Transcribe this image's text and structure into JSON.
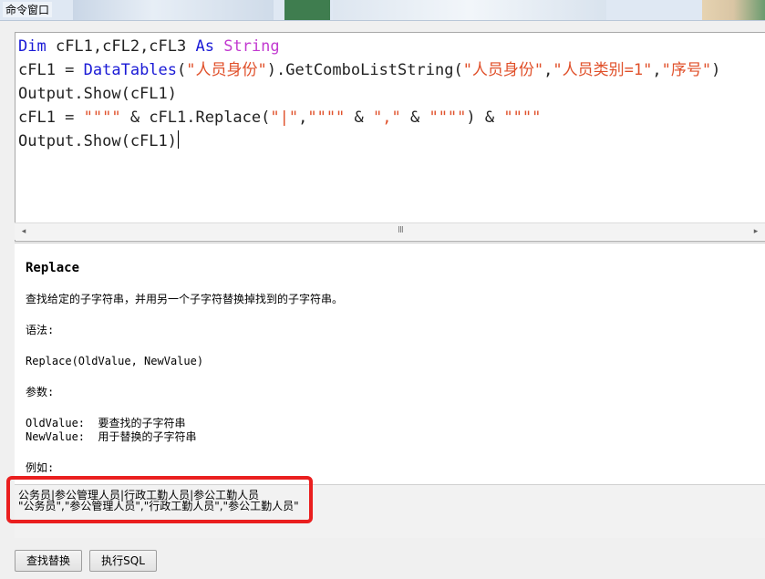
{
  "window": {
    "title": "命令窗口"
  },
  "editor": {
    "lines": [
      [
        {
          "c": "kw",
          "t": "Dim"
        },
        {
          "c": "",
          "t": " cFL1,cFL2,cFL3 "
        },
        {
          "c": "kw",
          "t": "As"
        },
        {
          "c": "",
          "t": " "
        },
        {
          "c": "ty",
          "t": "String"
        }
      ],
      [
        {
          "c": "",
          "t": "cFL1 = "
        },
        {
          "c": "kw",
          "t": "DataTables"
        },
        {
          "c": "",
          "t": "("
        },
        {
          "c": "str",
          "t": "\"人员身份\""
        },
        {
          "c": "",
          "t": ").GetComboListString("
        },
        {
          "c": "str",
          "t": "\"人员身份\""
        },
        {
          "c": "",
          "t": ","
        },
        {
          "c": "str",
          "t": "\"人员类别=1\""
        },
        {
          "c": "",
          "t": ","
        },
        {
          "c": "str",
          "t": "\"序号\""
        },
        {
          "c": "",
          "t": ")"
        }
      ],
      [
        {
          "c": "",
          "t": "Output.Show(cFL1)"
        }
      ],
      [
        {
          "c": "",
          "t": "cFL1 = "
        },
        {
          "c": "str",
          "t": "\"\"\"\""
        },
        {
          "c": "",
          "t": " & cFL1.Replace("
        },
        {
          "c": "str",
          "t": "\"|\""
        },
        {
          "c": "",
          "t": ","
        },
        {
          "c": "str",
          "t": "\"\"\"\""
        },
        {
          "c": "",
          "t": " & "
        },
        {
          "c": "str",
          "t": "\",\""
        },
        {
          "c": "",
          "t": " & "
        },
        {
          "c": "str",
          "t": "\"\"\"\""
        },
        {
          "c": "",
          "t": ") & "
        },
        {
          "c": "str",
          "t": "\"\"\"\""
        }
      ],
      [
        {
          "c": "",
          "t": "Output.Show(cFL1)"
        }
      ]
    ]
  },
  "scrollbar": {
    "left_arrow": "◂",
    "right_arrow": "▸",
    "grip": "III"
  },
  "help": {
    "title": "Replace",
    "lines": [
      "查找给定的子字符串，并用另一个子字符替换掉找到的子字符串。",
      "语法:",
      "Replace(OldValue, NewValue)",
      "参数:",
      "OldValue:  要查找的子字符串",
      "NewValue:  用于替换的子字符串",
      "例如:"
    ]
  },
  "output": {
    "lines": [
      "公务员|参公管理人员|行政工勤人员|参公工勤人员",
      "\"公务员\",\"参公管理人员\",\"行政工勤人员\",\"参公工勤人员\""
    ]
  },
  "buttons": {
    "find_replace": "查找替换",
    "run_sql": "执行SQL"
  },
  "colors": {
    "keyword": "#1a1ad6",
    "type": "#c23ad0",
    "string": "#e0502a",
    "highlight": "#ea1f1f"
  }
}
